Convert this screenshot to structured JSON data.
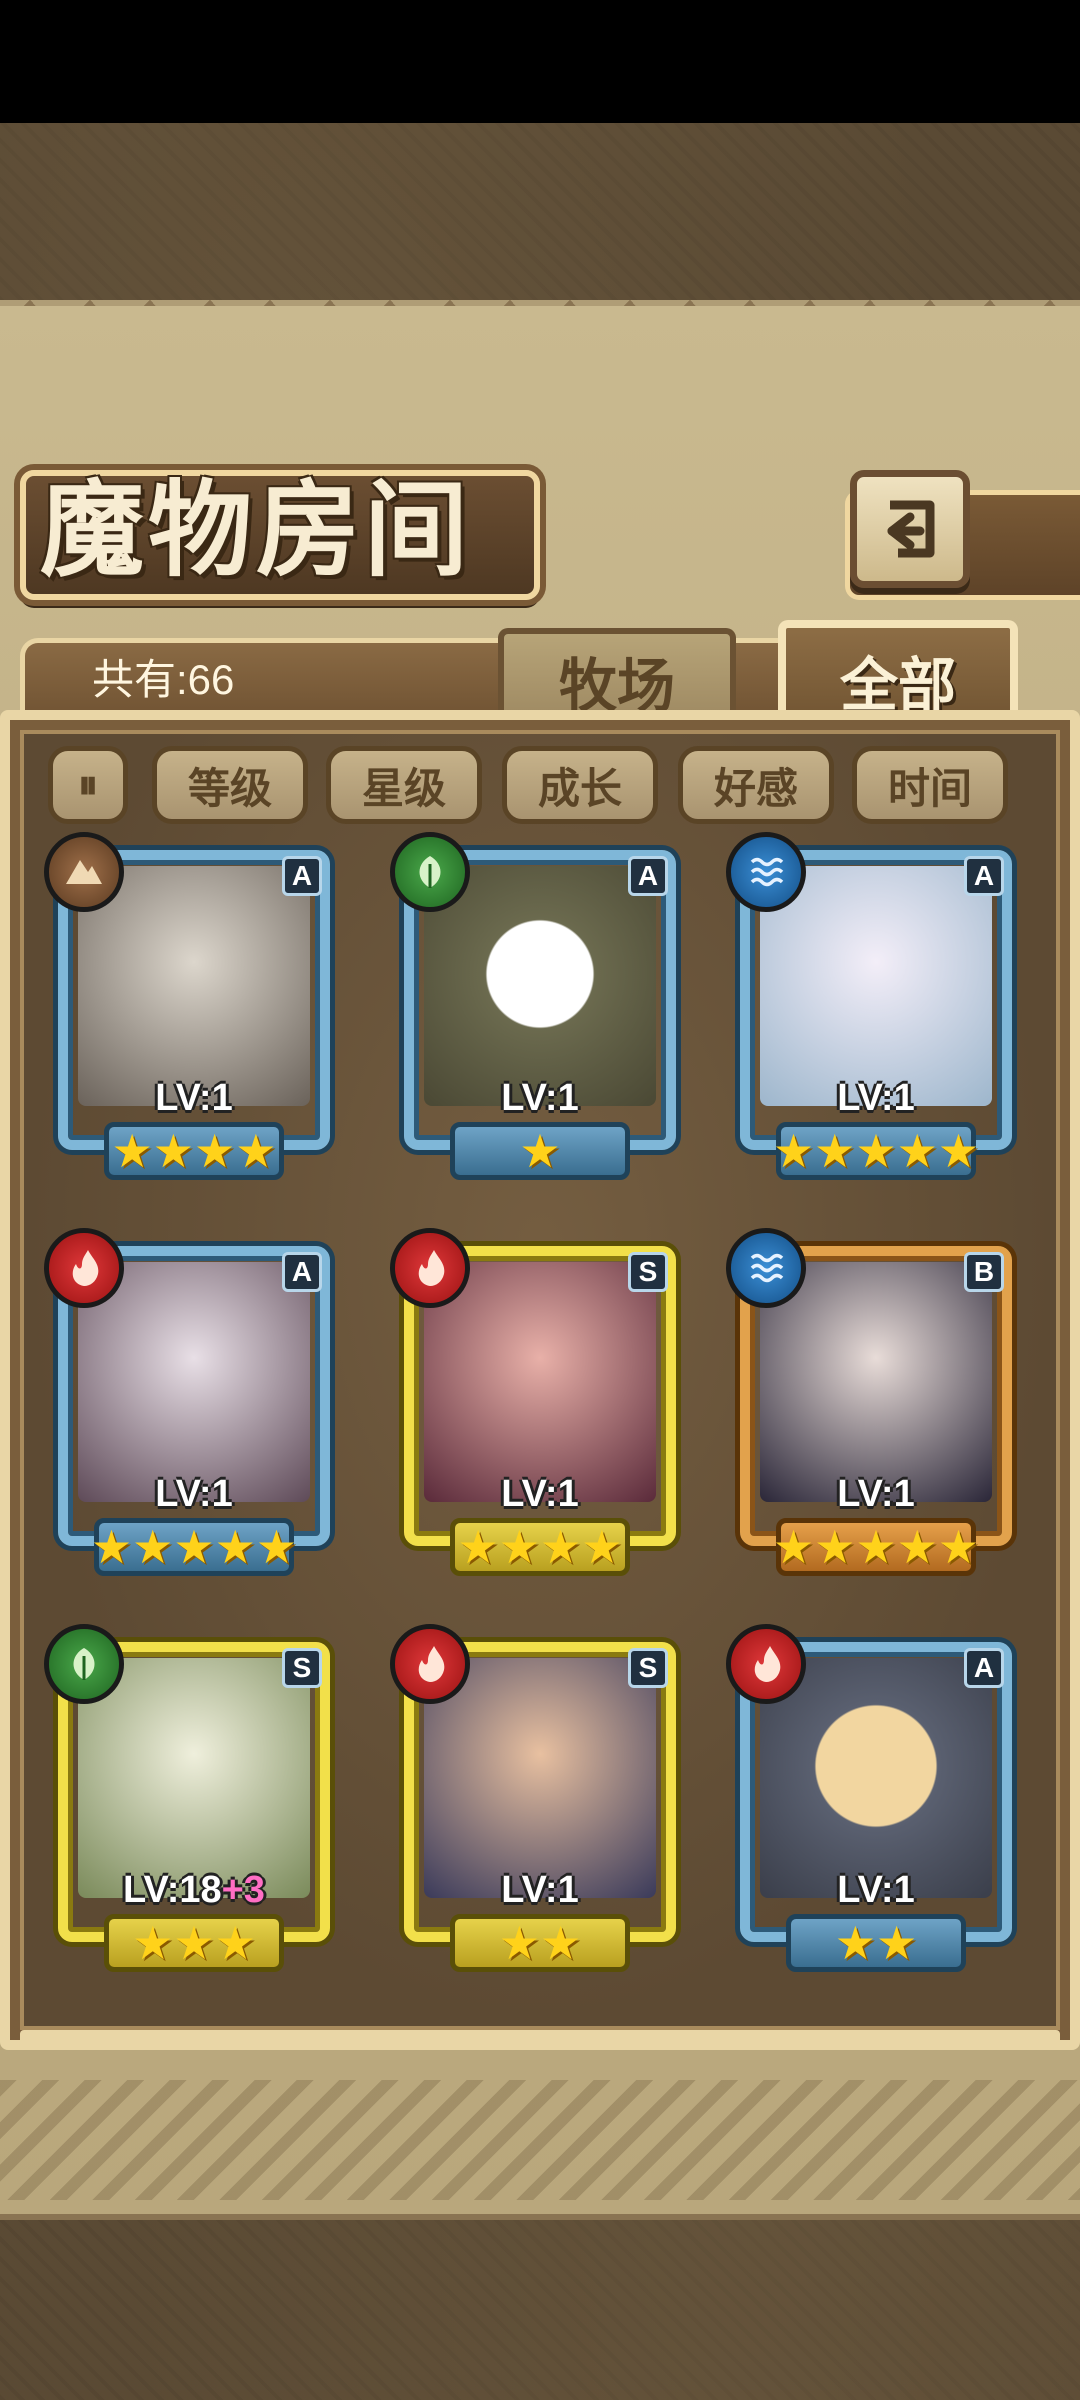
{
  "title": "魔物房间",
  "count_text": "共有:66",
  "tabs": {
    "pasture": "牧场",
    "all": "全部"
  },
  "sort": {
    "toggle_label": "⏸",
    "level": "等级",
    "star": "星级",
    "growth": "成长",
    "affection": "好感",
    "time": "时间"
  },
  "monsters": [
    {
      "element": "earth-icon",
      "rank": "A",
      "level": "LV:1",
      "bonus": "",
      "stars": "★★★★",
      "frame": "blue"
    },
    {
      "element": "leaf-icon",
      "rank": "A",
      "level": "LV:1",
      "bonus": "",
      "stars": "★",
      "frame": "blue"
    },
    {
      "element": "water-icon",
      "rank": "A",
      "level": "LV:1",
      "bonus": "",
      "stars": "★★★★★",
      "frame": "blue"
    },
    {
      "element": "fire-icon",
      "rank": "A",
      "level": "LV:1",
      "bonus": "",
      "stars": "★★★★★",
      "frame": "blue"
    },
    {
      "element": "fire-icon",
      "rank": "S",
      "level": "LV:1",
      "bonus": "",
      "stars": "★★★★",
      "frame": "gold"
    },
    {
      "element": "water-icon",
      "rank": "B",
      "level": "LV:1",
      "bonus": "",
      "stars": "★★★★★",
      "frame": "orange"
    },
    {
      "element": "leaf-icon",
      "rank": "S",
      "level": "LV:18",
      "bonus": "+3",
      "stars": "★★★",
      "frame": "gold"
    },
    {
      "element": "fire-icon",
      "rank": "S",
      "level": "LV:1",
      "bonus": "",
      "stars": "★★",
      "frame": "gold"
    },
    {
      "element": "fire-icon",
      "rank": "A",
      "level": "LV:1",
      "bonus": "",
      "stars": "★★",
      "frame": "blue"
    }
  ]
}
